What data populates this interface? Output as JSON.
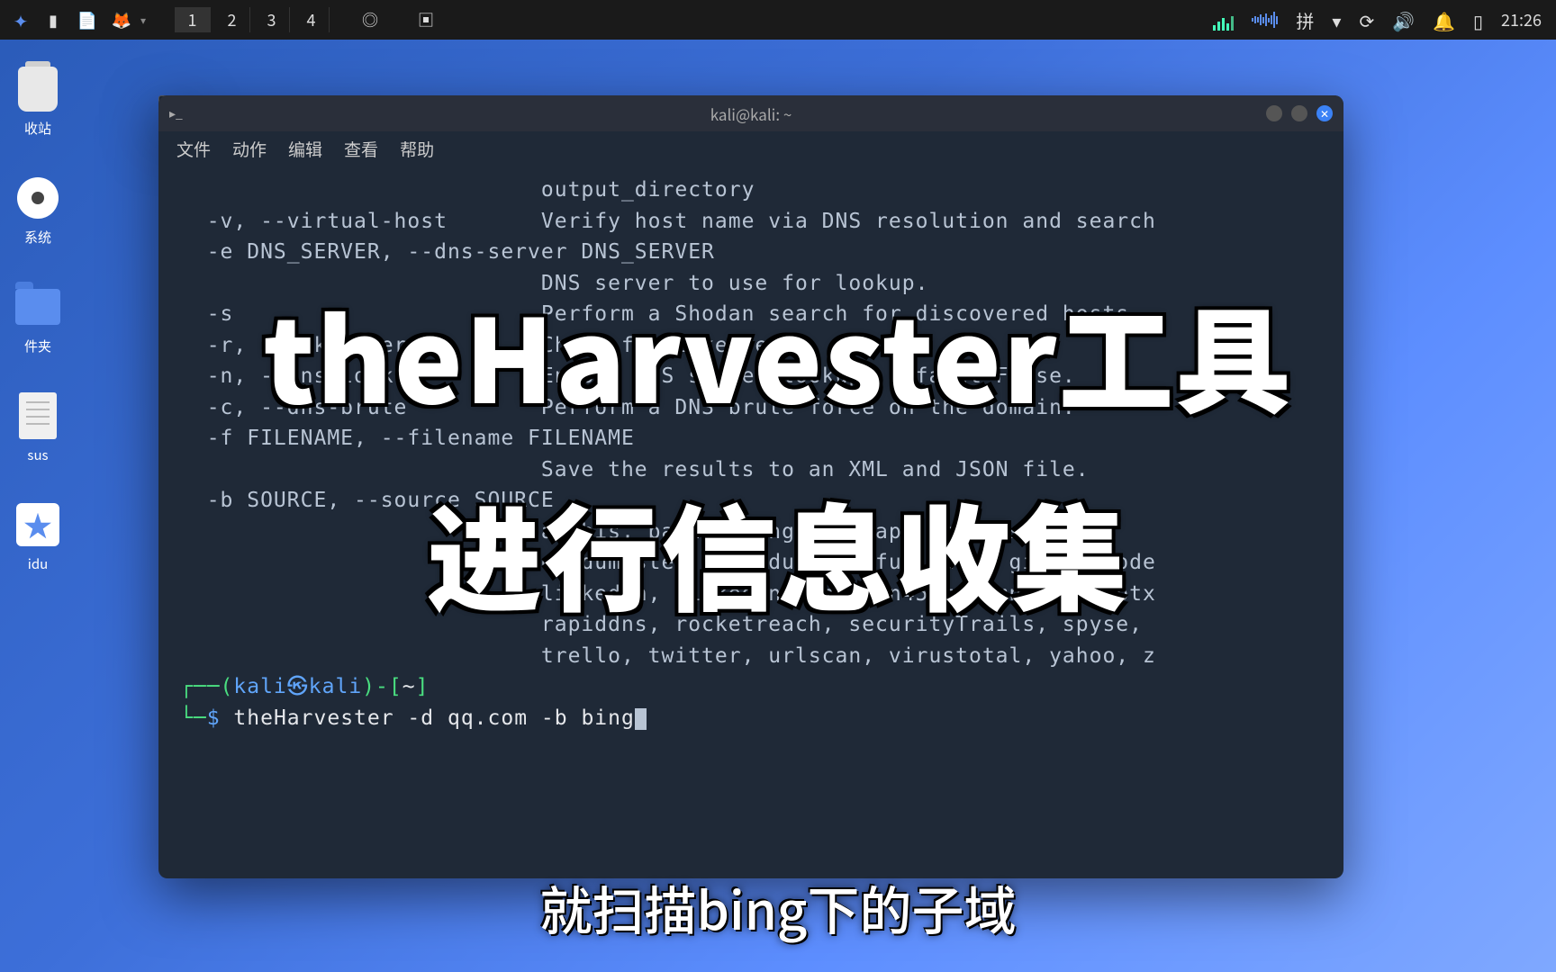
{
  "taskbar": {
    "workspaces": [
      "1",
      "2",
      "3",
      "4"
    ],
    "ime": "拼",
    "clock": "21:26"
  },
  "desktop": {
    "icons": [
      {
        "label": "收站",
        "type": "trash"
      },
      {
        "label": "系统",
        "type": "disc"
      },
      {
        "label": "件夹",
        "type": "folder"
      },
      {
        "label": "sus",
        "type": "file"
      },
      {
        "label": "idu",
        "type": "star"
      }
    ]
  },
  "terminal": {
    "title": "kali@kali: ~",
    "menus": [
      "文件",
      "动作",
      "编辑",
      "查看",
      "帮助"
    ],
    "output_lines": [
      "                           output_directory",
      "  -v, --virtual-host       Verify host name via DNS resolution and search",
      "  -e DNS_SERVER, --dns-server DNS_SERVER",
      "                           DNS server to use for lookup.",
      "  -s                       Perform a Shodan search for discovered hosts.",
      "  -r, --take-over          Check for takeovers.",
      "  -n, --dns-lookup         Enable DNS server lookup, default False.",
      "  -c, --dns-brute          Perform a DNS brute force on the domain.",
      "  -f FILENAME, --filename FILENAME",
      "                           Save the results to an XML and JSON file.",
      "  -b SOURCE, --source SOURCE",
      "                           anubis, baidu, bing, bingapi, censys, buff",
      "                           dnsdumpster, duckduckgo, fullhunt, github-code",
      "                           linkedin, linkedin_links, n45ht, omnisint, otx",
      "                           rapiddns, rocketreach, securityTrails, spyse,",
      "                           trello, twitter, urlscan, virustotal, yahoo, z"
    ],
    "prompt_user": "kali㉿kali",
    "prompt_path": "~",
    "command": "theHarvester -d qq.com -b bing"
  },
  "overlay": {
    "line1": "theHarvester工具",
    "line2": "进行信息收集"
  },
  "subtitle": "就扫描bing下的子域"
}
